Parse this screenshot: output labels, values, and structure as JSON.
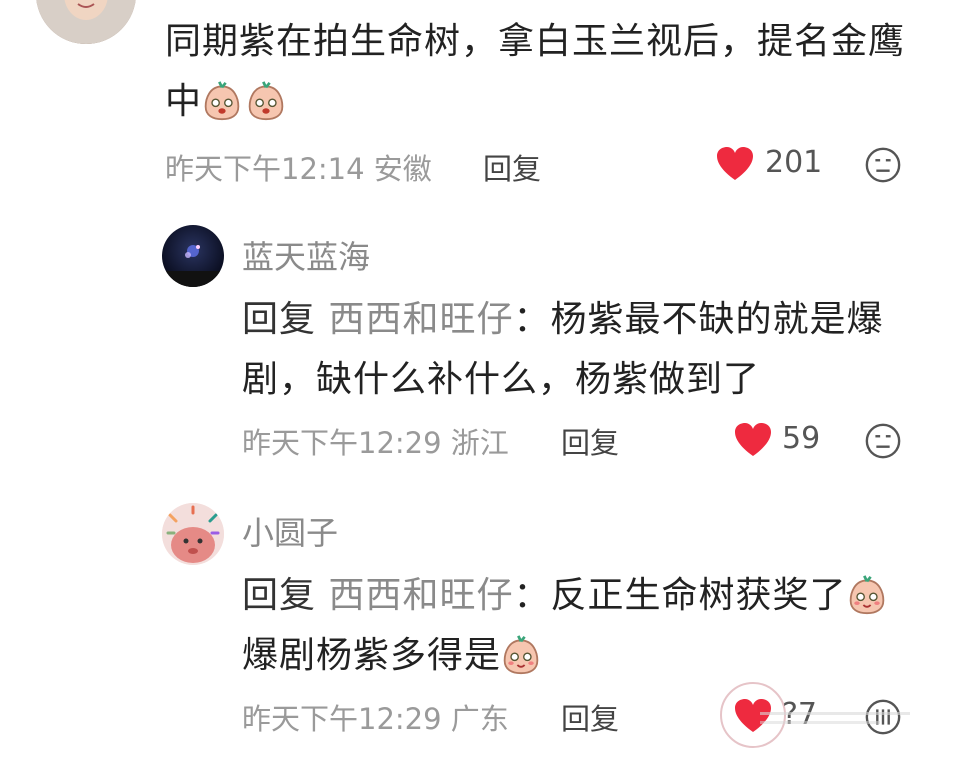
{
  "comment": {
    "text_line1": "同期紫在拍生命树，拿白玉兰视后，提名金鹰",
    "text_line2": "中",
    "meta": "昨天下午12:14 安徽",
    "reply_label": "回复",
    "likes": "201"
  },
  "replies": [
    {
      "username": "蓝天蓝海",
      "reply_prefix": "回复",
      "target": "西西和旺仔",
      "colon": "：",
      "text_line1": "杨紫最不缺的就是爆",
      "text_line2": "剧，缺什么补什么，杨紫做到了",
      "meta": "昨天下午12:29 浙江",
      "reply_label": "回复",
      "likes": "59"
    },
    {
      "username": "小圆子",
      "reply_prefix": "回复",
      "target": "西西和旺仔",
      "colon": "：",
      "text_line1": "反正生命树获奖了",
      "text_line2": "爆剧杨紫多得是",
      "meta": "昨天下午12:29 广东",
      "reply_label": "回复",
      "likes": "?7"
    }
  ],
  "colors": {
    "heart": "#ee2a3f",
    "text": "#222222",
    "muted": "#9a9a9a"
  },
  "icons": [
    "heart-icon",
    "smiley-icon",
    "crying-emoji"
  ]
}
